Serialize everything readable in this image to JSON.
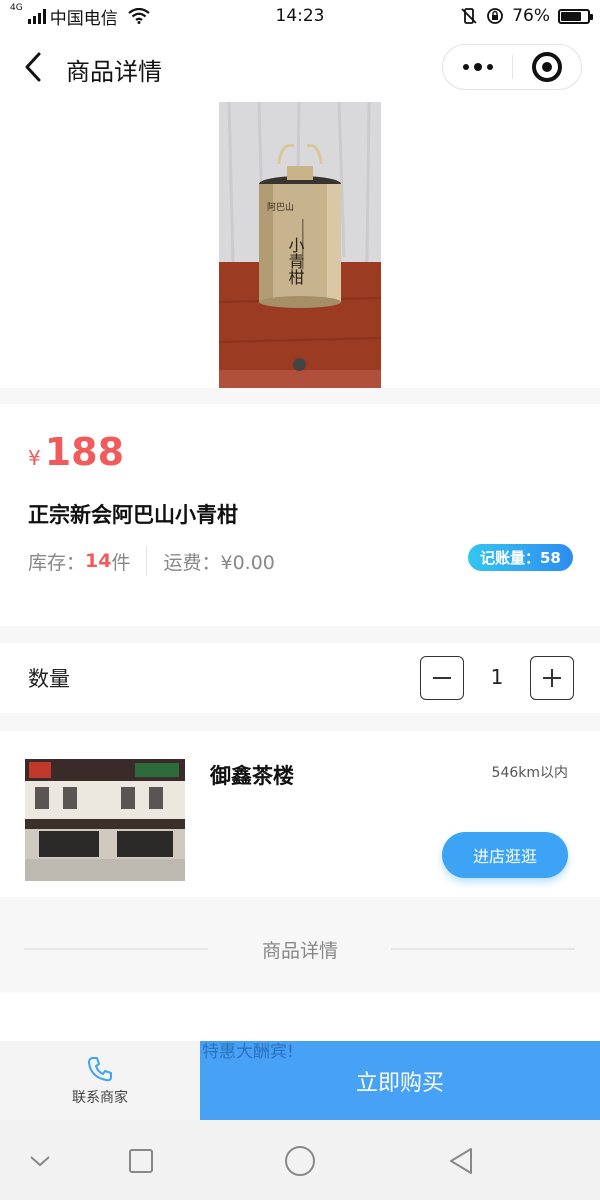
{
  "status_bar": {
    "network": "4G",
    "carrier": "中国电信",
    "time": "14:23",
    "battery_percent": "76%",
    "battery_level": 0.76
  },
  "nav": {
    "title": "商品详情",
    "icons": [
      "back-arrow-icon",
      "more-dots-icon",
      "target-close-icon"
    ]
  },
  "product": {
    "price_symbol": "¥",
    "price": "188",
    "name": "正宗新会阿巴山小青柑",
    "stock_label": "库存：",
    "stock_count": "14",
    "stock_unit": "件",
    "shipping": "运费：¥0.00",
    "badge": "记账量：58",
    "image_count": 1,
    "image_text": "小青柑"
  },
  "quantity": {
    "label": "数量",
    "value": "1"
  },
  "shop": {
    "name": "御鑫茶楼",
    "distance": "546km以内",
    "enter_button": "进店逛逛"
  },
  "details_section": {
    "label": "商品详情"
  },
  "bottom_bar": {
    "contact_label": "联系商家",
    "buy_label": "立即购买",
    "marquee": "特惠大酬宾!"
  },
  "colors": {
    "accent_blue": "#47a2f5",
    "price_red": "#f25b5b",
    "badge_gradient": [
      "#35c5f0",
      "#2d8cf0"
    ]
  }
}
